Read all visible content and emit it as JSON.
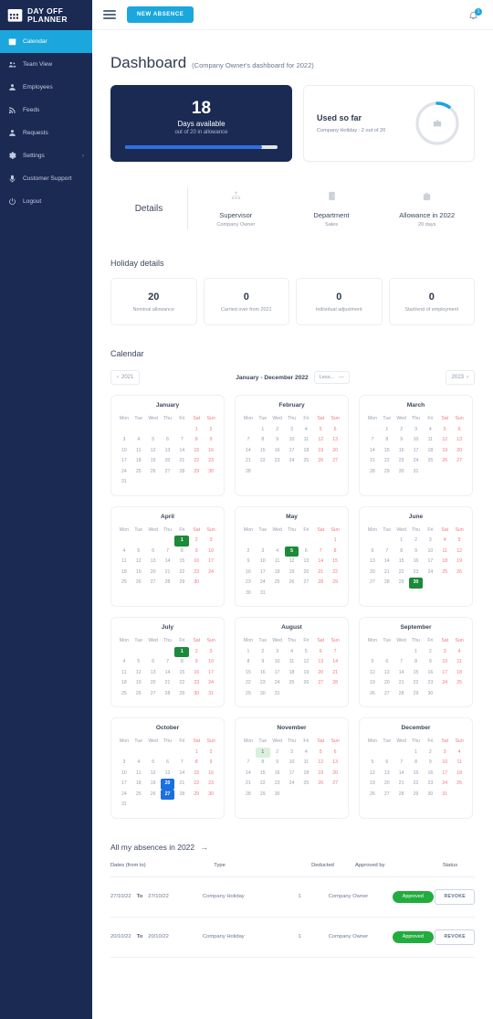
{
  "brand": {
    "line1": "DAY OFF",
    "line2": "PLANNER",
    "icon": "calendar-icon"
  },
  "sidebar": {
    "items": [
      {
        "label": "Calendar",
        "icon": "calendar-icon",
        "active": true
      },
      {
        "label": "Team View",
        "icon": "people-icon",
        "active": false
      },
      {
        "label": "Employees",
        "icon": "person-icon",
        "active": false
      },
      {
        "label": "Feeds",
        "icon": "rss-icon",
        "active": false
      },
      {
        "label": "Requests",
        "icon": "person-request-icon",
        "active": false
      },
      {
        "label": "Settings",
        "icon": "gear-icon",
        "active": false,
        "caret": "›"
      },
      {
        "label": "Customer Support",
        "icon": "support-icon",
        "active": false
      },
      {
        "label": "Logout",
        "icon": "power-icon",
        "active": false
      }
    ]
  },
  "topbar": {
    "menu_icon": "hamburger-icon",
    "new_absence_label": "NEW ABSENCE",
    "bell_icon": "bell-icon",
    "bell_badge": "1"
  },
  "header": {
    "title": "Dashboard",
    "subtitle": "(Company Owner's dashboard for 2022)"
  },
  "days_card": {
    "number": "18",
    "label": "Days available",
    "sub": "out of 20 in allowance",
    "progress_percent": 90,
    "bar_color": "#2f6fe0",
    "bg_color": "#1b2a53"
  },
  "used_card": {
    "title": "Used so far",
    "subtitle": "Company Holiday : 2 out of 20",
    "percent": 10,
    "ring_color": "#1ba7dd",
    "track_color": "#dfe2e8",
    "icon": "briefcase-icon"
  },
  "details": {
    "label": "Details",
    "columns": [
      {
        "icon": "org-chart-icon",
        "title": "Supervisor",
        "sub": "Company Owner"
      },
      {
        "icon": "department-icon",
        "title": "Department",
        "sub": "Sales"
      },
      {
        "icon": "suitcase-icon",
        "title": "Allowance in 2022",
        "sub": "20 days"
      }
    ]
  },
  "holiday_details": {
    "heading": "Holiday details",
    "stats": [
      {
        "num": "20",
        "label": "Nominal allowance"
      },
      {
        "num": "0",
        "label": "Carried over from 2021"
      },
      {
        "num": "0",
        "label": "Individual adjustment"
      },
      {
        "num": "0",
        "label": "Start/end of employment"
      }
    ]
  },
  "calendar": {
    "heading": "Calendar",
    "prev_year": "2021",
    "next_year": "2023",
    "range": "January - December 2022",
    "less_label": "Less...",
    "less_icon": "minus-icon",
    "prev_icon": "chevron-left-icon",
    "next_icon": "chevron-right-icon",
    "dow": [
      "Mon",
      "Tue",
      "Wed",
      "Thu",
      "Fri",
      "Sat",
      "Sun"
    ],
    "months": [
      {
        "name": "January",
        "start": 5,
        "days": 31,
        "holidays": [],
        "light_holidays": [],
        "absences": []
      },
      {
        "name": "February",
        "start": 1,
        "days": 28,
        "holidays": [],
        "light_holidays": [],
        "absences": []
      },
      {
        "name": "March",
        "start": 1,
        "days": 31,
        "holidays": [],
        "light_holidays": [],
        "absences": []
      },
      {
        "name": "April",
        "start": 4,
        "days": 30,
        "holidays": [
          1
        ],
        "light_holidays": [],
        "absences": []
      },
      {
        "name": "May",
        "start": 6,
        "days": 31,
        "holidays": [
          5
        ],
        "light_holidays": [],
        "absences": []
      },
      {
        "name": "June",
        "start": 2,
        "days": 30,
        "holidays": [
          30
        ],
        "light_holidays": [],
        "absences": []
      },
      {
        "name": "July",
        "start": 4,
        "days": 31,
        "holidays": [
          1
        ],
        "light_holidays": [],
        "absences": []
      },
      {
        "name": "August",
        "start": 0,
        "days": 31,
        "holidays": [],
        "light_holidays": [],
        "absences": []
      },
      {
        "name": "September",
        "start": 3,
        "days": 30,
        "holidays": [],
        "light_holidays": [],
        "absences": []
      },
      {
        "name": "October",
        "start": 5,
        "days": 31,
        "holidays": [],
        "light_holidays": [],
        "absences": [
          20,
          27
        ]
      },
      {
        "name": "November",
        "start": 1,
        "days": 30,
        "holidays": [],
        "light_holidays": [
          1
        ],
        "absences": []
      },
      {
        "name": "December",
        "start": 3,
        "days": 31,
        "holidays": [],
        "light_holidays": [],
        "absences": []
      }
    ]
  },
  "absences": {
    "title": "All my absences in 2022",
    "arrow": "→",
    "columns": [
      "Dates (from to)",
      "Type",
      "Deducted",
      "Approved by",
      "Status"
    ],
    "to_word": "To",
    "action_label": "REVOKE",
    "rows": [
      {
        "from": "27/10/22",
        "to": "27/10/22",
        "type": "Company Holiday",
        "deducted": "1",
        "approved_by": "Company Owner",
        "status": "Approved"
      },
      {
        "from": "20/10/22",
        "to": "20/10/22",
        "type": "Company Holiday",
        "deducted": "1",
        "approved_by": "Company Owner",
        "status": "Approved"
      }
    ]
  }
}
